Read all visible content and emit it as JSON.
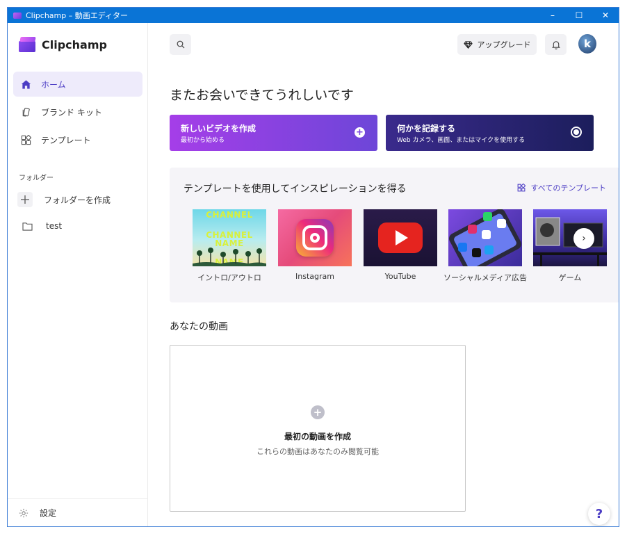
{
  "window": {
    "title": "Clipchamp – 動画エディター",
    "minimize": "–",
    "maximize": "☐",
    "close": "✕"
  },
  "sidebar": {
    "brand": "Clipchamp",
    "items": [
      {
        "label": "ホーム",
        "icon": "home-icon",
        "active": true
      },
      {
        "label": "ブランド キット",
        "icon": "brand-kit-icon",
        "active": false
      },
      {
        "label": "テンプレート",
        "icon": "templates-icon",
        "active": false
      }
    ],
    "folder_header": "フォルダー",
    "folders": [
      {
        "label": "フォルダーを作成",
        "icon": "plus-icon"
      },
      {
        "label": "test",
        "icon": "folder-icon"
      }
    ],
    "settings_label": "設定"
  },
  "header": {
    "upgrade_label": "アップグレード",
    "avatar_initial": "k"
  },
  "main": {
    "greeting": "またお会いできてうれしいです",
    "cards": {
      "new_video": {
        "title": "新しいビデオを作成",
        "subtitle": "最初から始める"
      },
      "record": {
        "title": "何かを記録する",
        "subtitle": "Web カメラ、画面、またはマイクを使用する"
      }
    },
    "templates": {
      "title": "テンプレートを使用してインスピレーションを得る",
      "all_link": "すべてのテンプレート",
      "items": [
        {
          "label": "イントロ/アウトロ",
          "thumb_text": [
            "CHANNEL",
            "CHANNEL",
            "NAME",
            "NAME"
          ]
        },
        {
          "label": "Instagram"
        },
        {
          "label": "YouTube"
        },
        {
          "label": "ソーシャルメディア広告"
        },
        {
          "label": "ゲーム"
        }
      ],
      "next": "›"
    },
    "videos": {
      "title": "あなたの動画",
      "empty_title": "最初の動画を作成",
      "empty_subtitle": "これらの動画はあなたのみ閲覧可能"
    },
    "help": "?"
  },
  "colors": {
    "accent": "#4b3cc4",
    "titlebar": "#0a74d6",
    "new_card_start": "#a53ee8",
    "record_card": "#1c1e5c"
  }
}
